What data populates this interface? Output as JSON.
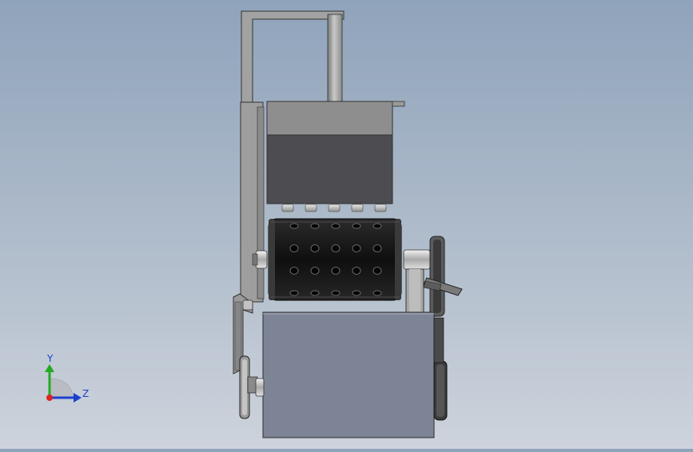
{
  "viewport": {
    "background_top": "#8fa3bb",
    "background_bottom": "#cdd3dc"
  },
  "triad": {
    "y_label": "Y",
    "z_label": "Z",
    "y_color": "#22aa22",
    "z_color": "#1d3fd0",
    "origin_color": "#dd2222"
  },
  "model": {
    "roller_holes": {
      "columns": 5,
      "rows": 4
    },
    "top_pins": 5,
    "colors": {
      "frame": "#9c9c9c",
      "frame_dark": "#6e6e6e",
      "hopper_light": "#8e8e8e",
      "hopper_dark": "#4d4c50",
      "roller": "#151515",
      "base_box": "#7d8496",
      "wheel": "#2a2a2a"
    }
  }
}
